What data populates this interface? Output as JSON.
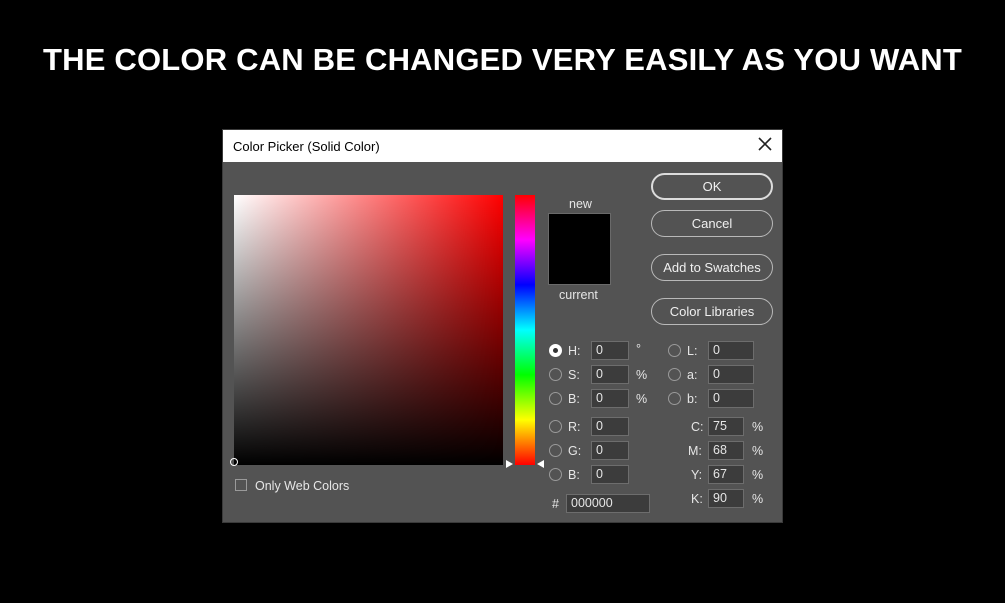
{
  "headline": "THE COLOR CAN BE CHANGED VERY EASILY AS YOU WANT",
  "dialog": {
    "title": "Color Picker (Solid Color)",
    "preview": {
      "new_label": "new",
      "current_label": "current",
      "color": "#000000"
    },
    "buttons": {
      "ok": "OK",
      "cancel": "Cancel",
      "add_swatches": "Add to Swatches",
      "libraries": "Color Libraries"
    },
    "hsb": {
      "h": {
        "label": "H:",
        "value": "0",
        "unit": "°"
      },
      "s": {
        "label": "S:",
        "value": "0",
        "unit": "%"
      },
      "b": {
        "label": "B:",
        "value": "0",
        "unit": "%"
      }
    },
    "rgb": {
      "r": {
        "label": "R:",
        "value": "0"
      },
      "g": {
        "label": "G:",
        "value": "0"
      },
      "b": {
        "label": "B:",
        "value": "0"
      }
    },
    "lab": {
      "l": {
        "label": "L:",
        "value": "0"
      },
      "a": {
        "label": "a:",
        "value": "0"
      },
      "b": {
        "label": "b:",
        "value": "0"
      }
    },
    "cmyk": {
      "c": {
        "label": "C:",
        "value": "75",
        "unit": "%"
      },
      "m": {
        "label": "M:",
        "value": "68",
        "unit": "%"
      },
      "y": {
        "label": "Y:",
        "value": "67",
        "unit": "%"
      },
      "k": {
        "label": "K:",
        "value": "90",
        "unit": "%"
      }
    },
    "hex": {
      "label": "#",
      "value": "000000"
    },
    "web_colors": {
      "label": "Only Web Colors",
      "checked": false
    }
  }
}
